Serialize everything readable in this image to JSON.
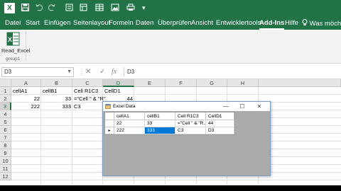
{
  "titlebar": {
    "logo": "X",
    "autosave_icon": "save-icon",
    "undo_icon": "undo-icon",
    "redo_icon": "redo-icon",
    "qat_icons": [
      "touch-mode-icon",
      "form-icon",
      "table-icon",
      "image-icon",
      "customize-qat-icon"
    ]
  },
  "tabs": [
    "Datei",
    "Start",
    "Einfügen",
    "Seitenlayout",
    "Formeln",
    "Daten",
    "Überprüfen",
    "Ansicht",
    "Entwicklertools",
    "Add-Ins",
    "Hilfe"
  ],
  "active_tab": "Add-Ins",
  "tell_me": "Was möchter",
  "ribbon": {
    "button_label": "Read_Excel",
    "group_label": "group1"
  },
  "formula_bar": {
    "name_box": "D3",
    "formula": "D3",
    "icons": [
      "cancel-icon",
      "enter-icon",
      "function-icon"
    ]
  },
  "grid": {
    "columns": [
      "A",
      "B",
      "C",
      "D",
      "E",
      "F",
      "G",
      "H"
    ],
    "rows": [
      "1",
      "2",
      "3",
      "4",
      "5",
      "6",
      "7",
      "8",
      "9",
      "10",
      "11",
      "12"
    ],
    "selected_cell": "D3",
    "cells": {
      "A1": "cellA1",
      "B1": "cellB1",
      "C1": "Cell R1C3",
      "D1": "CellD1",
      "A2": "22",
      "B2": "33",
      "C2": "=\"Cell \" & \"R\"",
      "D2": "44",
      "A3": "222",
      "B3": "333",
      "C3": "C3"
    }
  },
  "dialog": {
    "title": "Excel Data",
    "controls": {
      "minimize": "—",
      "maximize": "☐",
      "close": "✕"
    },
    "columns": [
      "cellA1",
      "cellB1",
      "Cell R1C3",
      "CellD1"
    ],
    "rows": [
      [
        "22",
        "33",
        "=\"Cell \" & \"R...",
        "44"
      ],
      [
        "222",
        "333",
        "C3",
        "D3"
      ]
    ],
    "current_row_marker": "▸",
    "selected": {
      "row": 1,
      "col": 1
    }
  },
  "colors": {
    "excel_green": "#217346",
    "selection_blue": "#0078d7",
    "dialog_bg": "#ababab"
  }
}
